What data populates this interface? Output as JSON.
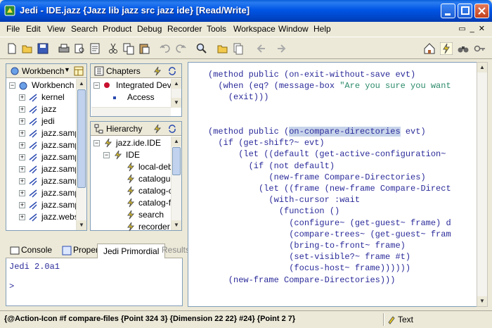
{
  "window": {
    "title": "Jedi - IDE.jazz {Jazz lib jazz src jazz ide} [Read/Write]"
  },
  "menu": [
    "File",
    "Edit",
    "View",
    "Search",
    "Product",
    "Debug",
    "Recorder",
    "Tools",
    "Workspace",
    "Window",
    "Help"
  ],
  "workbench": {
    "tab_label": "Workbench",
    "root": "Workbench",
    "items": [
      "kernel",
      "jazz",
      "jedi",
      "jazz.samp",
      "jazz.samp",
      "jazz.samp",
      "jazz.samp",
      "jazz.samp",
      "jazz.samp",
      "jazz.samp",
      "jazz.webs"
    ]
  },
  "chapters": {
    "title": "Chapters",
    "items": [
      "Integrated Devel",
      "Access"
    ]
  },
  "hierarchy": {
    "title": "Hierarchy",
    "root": "jazz.ide.IDE",
    "child": "IDE",
    "items": [
      "local-debu",
      "cataloguer",
      "catalog-co",
      "catalog-file",
      "search",
      "recorder"
    ]
  },
  "editor": {
    "lines": [
      {
        "pre": "(method public (",
        "hl": "",
        "post": "on-exit-without-save evt)",
        "str": ""
      },
      {
        "pre": "  (when (eq? (message-box ",
        "hl": "",
        "post": "",
        "str": "\"Are you sure you want"
      },
      {
        "pre": "    (exit)))",
        "hl": "",
        "post": "",
        "str": ""
      },
      {
        "pre": "",
        "hl": "",
        "post": "",
        "str": ""
      },
      {
        "pre": "",
        "hl": "",
        "post": "",
        "str": ""
      },
      {
        "pre": "(method public (",
        "hl": "on-compare-directories",
        "post": " evt)",
        "str": ""
      },
      {
        "pre": "  (if (get-shift?~ evt)",
        "hl": "",
        "post": "",
        "str": ""
      },
      {
        "pre": "      (let ((default (get-active-configuration~",
        "hl": "",
        "post": "",
        "str": ""
      },
      {
        "pre": "        (if (not default)",
        "hl": "",
        "post": "",
        "str": ""
      },
      {
        "pre": "            (new-frame Compare-Directories)",
        "hl": "",
        "post": "",
        "str": ""
      },
      {
        "pre": "          (let ((frame (new-frame Compare-Direct",
        "hl": "",
        "post": "",
        "str": ""
      },
      {
        "pre": "            (with-cursor :wait",
        "hl": "",
        "post": "",
        "str": ""
      },
      {
        "pre": "              (function ()",
        "hl": "",
        "post": "",
        "str": ""
      },
      {
        "pre": "                (configure~ (get-guest~ frame) d",
        "hl": "",
        "post": "",
        "str": ""
      },
      {
        "pre": "                (compare-trees~ (get-guest~ fram",
        "hl": "",
        "post": "",
        "str": ""
      },
      {
        "pre": "                (bring-to-front~ frame)",
        "hl": "",
        "post": "",
        "str": ""
      },
      {
        "pre": "                (set-visible?~ frame #t)",
        "hl": "",
        "post": "",
        "str": ""
      },
      {
        "pre": "                (focus-host~ frame))))))",
        "hl": "",
        "post": "",
        "str": ""
      },
      {
        "pre": "    (new-frame Compare-Directories)))",
        "hl": "",
        "post": "",
        "str": ""
      }
    ]
  },
  "console": {
    "tabs": [
      "Console",
      "Proper",
      "Jedi Primordial",
      "Results"
    ],
    "lines": [
      "Jedi 2.0a1",
      "",
      ">"
    ]
  },
  "status": {
    "message": "{@Action-Icon #f compare-files {Point 324 3} {Dimension 22 22} #24} {Point 2 7}",
    "mode": "Text"
  }
}
